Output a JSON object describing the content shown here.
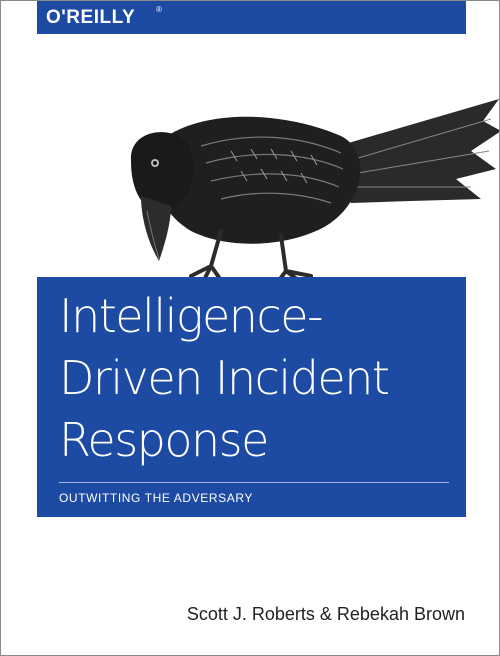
{
  "publisher": {
    "name": "O'REILLY",
    "mark": "®"
  },
  "cover": {
    "title_lines": [
      "Intelligence-",
      "Driven Incident",
      "Response"
    ],
    "subtitle": "OUTWITTING THE ADVERSARY",
    "authors": "Scott J. Roberts & Rebekah Brown"
  },
  "colors": {
    "brand_blue": "#1d4aa2",
    "text_white": "#ffffff",
    "author_text": "#222222"
  },
  "icons": {
    "cover_animal": "crow-illustration"
  }
}
